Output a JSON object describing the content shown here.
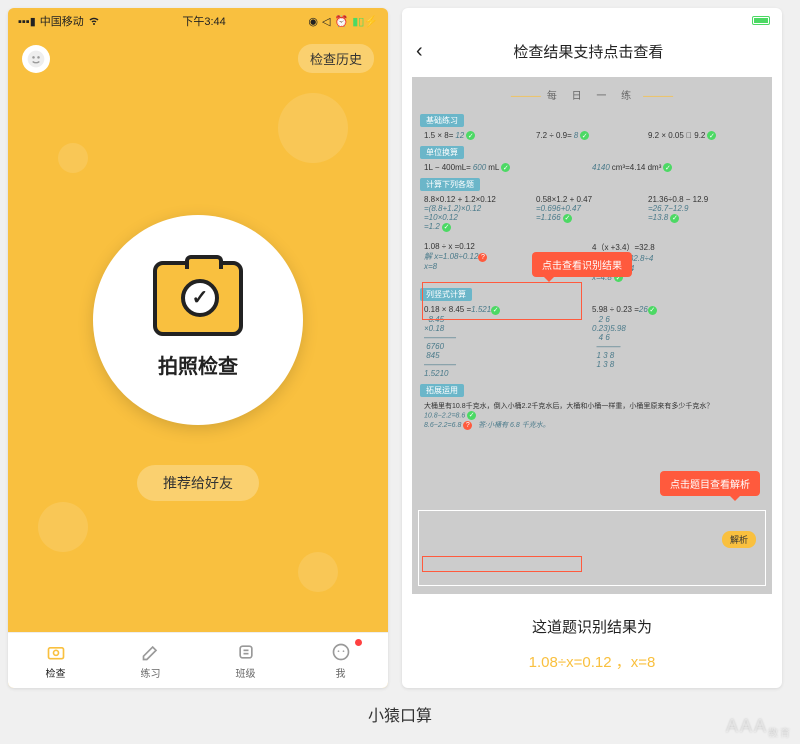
{
  "caption": "小猿口算",
  "watermark": "AAA教育",
  "left": {
    "status": {
      "carrier": "中国移动",
      "time": "下午3:44"
    },
    "history_btn": "检查历史",
    "camera_label": "拍照检查",
    "recommend_btn": "推荐给好友",
    "tabs": [
      {
        "label": "检查",
        "active": true
      },
      {
        "label": "练习",
        "active": false
      },
      {
        "label": "班级",
        "active": false
      },
      {
        "label": "我",
        "active": false,
        "dot": true
      }
    ]
  },
  "right": {
    "title": "检查结果支持点击查看",
    "worksheet": {
      "title": "每 日 一 练",
      "sections": {
        "basic": "基础练习",
        "unit": "单位换算",
        "calc": "计算下列各题",
        "vertical": "列竖式计算",
        "extend": "拓展运用"
      },
      "basic_problems": [
        {
          "q": "1.5 × 8=",
          "a": "12",
          "ok": true
        },
        {
          "q": "7.2 ÷ 0.9=",
          "a": "8",
          "ok": true
        },
        {
          "q": "9.2 × 0.05 ⃝ 9.2",
          "a": "",
          "ok": true
        }
      ],
      "unit_problems": [
        {
          "q": "1L − 400mL=",
          "a": "600",
          "unit": "mL",
          "ok": true
        },
        {
          "q": "",
          "a": "4140",
          "unit": "cm³=4.14 dm³",
          "ok": true
        }
      ],
      "calc_problems": [
        {
          "q": "8.8×0.12 + 1.2×0.12",
          "lines": [
            "=(8.8+1.2)×0.12",
            "=10×0.12",
            "=1.2"
          ],
          "ok": true
        },
        {
          "q": "0.58×1.2 + 0.47",
          "lines": [
            "=0.696+0.47",
            "=1.166"
          ],
          "ok": true
        },
        {
          "q": "21.36÷0.8 − 12.9",
          "lines": [
            "=26.7−12.9",
            "=13.8"
          ],
          "ok": true
        }
      ],
      "solve": [
        {
          "q": "1.08 ÷ x =0.12",
          "lines": [
            "解  x=1.08÷0.12",
            "     x=8"
          ],
          "err": true
        },
        {
          "q": "4（x +3.4）=32.8",
          "lines": [
            "解: x+3.4=32.8÷4",
            "   x=32.8÷4−4",
            "   x=4.8"
          ],
          "ok": true
        }
      ],
      "vertical": [
        {
          "q": "0.18 × 8.45 =",
          "a": "1.521",
          "ok": true
        },
        {
          "q": "5.98 ÷ 0.23 =",
          "a": "26",
          "ok": true
        }
      ],
      "word_problem": "大桶里有10.8千克水，倒入小桶2.2千克水后，大桶和小桶一样重，小桶里原来有多少千克水？",
      "word_lines": [
        "10.8−2.2=8.6",
        "8.6−2.2=6.8",
        "答:小桶有 6.8 千克水。"
      ]
    },
    "tooltip1": "点击查看识别结果",
    "tooltip2": "点击题目查看解析",
    "analysis_btn": "解析",
    "result_text": "这道题识别结果为",
    "result_formula": "1.08÷x=0.12 ，x=8"
  }
}
